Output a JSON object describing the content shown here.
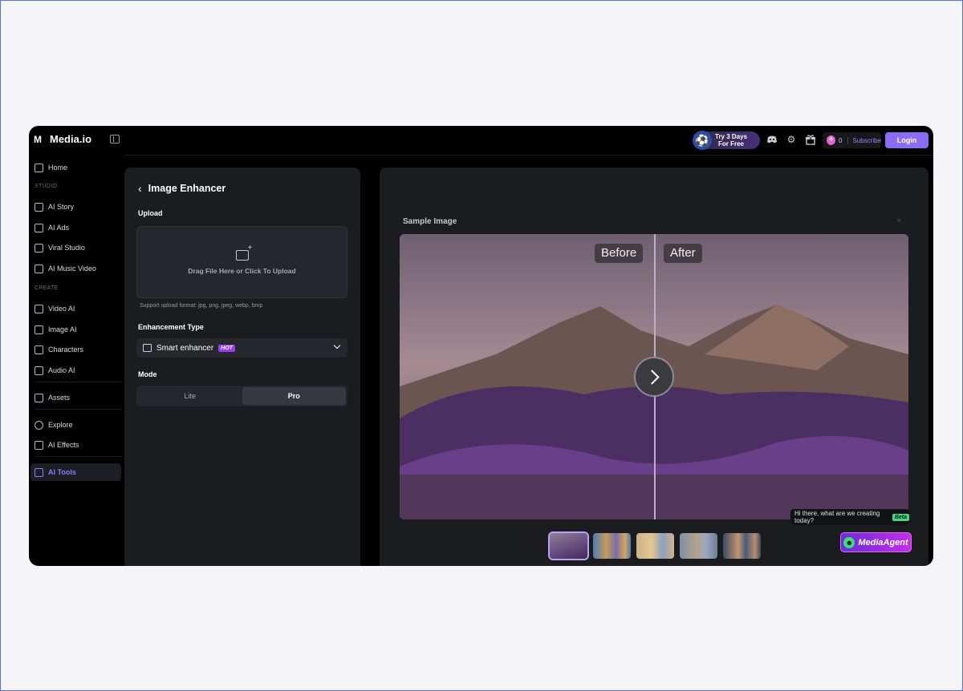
{
  "app": {
    "name": "Media.io",
    "logo_mark": "M"
  },
  "topbar": {
    "promo_line1": "Try 3 Days",
    "promo_line2": "For Free",
    "credits": "0",
    "subscribe_label": "Subscribe",
    "login_label": "Login"
  },
  "sidebar": {
    "home": "Home",
    "studio_section": "STUDIO",
    "ai_story": "AI Story",
    "ai_ads": "AI Ads",
    "viral_studio": "Viral Studio",
    "ai_music_video": "AI Music Video",
    "create_section": "CREATE",
    "video_ai": "Video AI",
    "image_ai": "Image AI",
    "characters": "Characters",
    "audio_ai": "Audio AI",
    "assets": "Assets",
    "explore": "Explore",
    "ai_effects": "AI Effects",
    "ai_tools": "AI Tools"
  },
  "tool": {
    "title": "Image Enhancer",
    "upload_label": "Upload",
    "upload_text": "Drag File Here or Click To Upload",
    "support_text": "Support upload format: jpg, png, jpeg, webp, bmp",
    "enhancement_label": "Enhancement Type",
    "enhancement_value": "Smart enhancer",
    "hot_badge": "HOT",
    "mode_label": "Mode",
    "mode_lite": "Lite",
    "mode_pro": "Pro",
    "selected_mode": "Pro"
  },
  "preview": {
    "title": "Sample Image",
    "close": "×",
    "before_label": "Before",
    "after_label": "After",
    "selected_thumbnail": 1,
    "thumbnail_count": 5
  },
  "agent": {
    "prompt": "Hi there, what are we creating today?",
    "beta": "Beta",
    "name": "MediaAgent"
  },
  "colors": {
    "accent": "#8c6cf6",
    "hot": "#9b3cf5",
    "beta": "#3ddc84"
  }
}
